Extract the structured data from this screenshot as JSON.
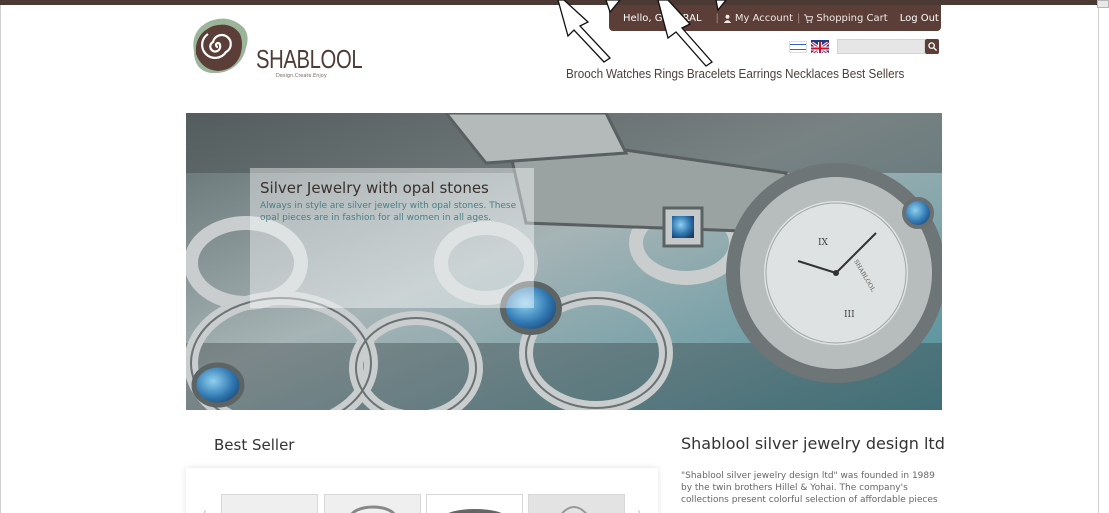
{
  "account_bar": {
    "greeting": "Hello, GENERAL",
    "my_account": "My Account",
    "shopping_cart": "Shopping Cart",
    "logout": "Log Out"
  },
  "logo": {
    "name": "SHABLOOL",
    "tagline": "Design.Create.Enjoy"
  },
  "nav": [
    "Brooch",
    "Watches",
    "Rings",
    "Bracelets",
    "Earrings",
    "Necklaces",
    "Best Sellers"
  ],
  "hero": {
    "title": "Silver Jewelry with opal stones",
    "text": "Always in style are silver jewelry with opal stones. These opal pieces are in fashion for all women in all ages.",
    "watch_brand": "SHABLOOL",
    "numeral_top": "IX",
    "numeral_right": "III"
  },
  "best_seller": {
    "title": "Best Seller"
  },
  "about": {
    "title": "Shablool silver jewelry design ltd",
    "text": "\"Shablool silver jewelry design ltd\" was founded in 1989 by the twin brothers Hillel & Yohai. The company's collections present colorful selection of affordable pieces"
  },
  "colors": {
    "brand_brown": "#5a3e37",
    "caption_text": "#4a7f86"
  }
}
